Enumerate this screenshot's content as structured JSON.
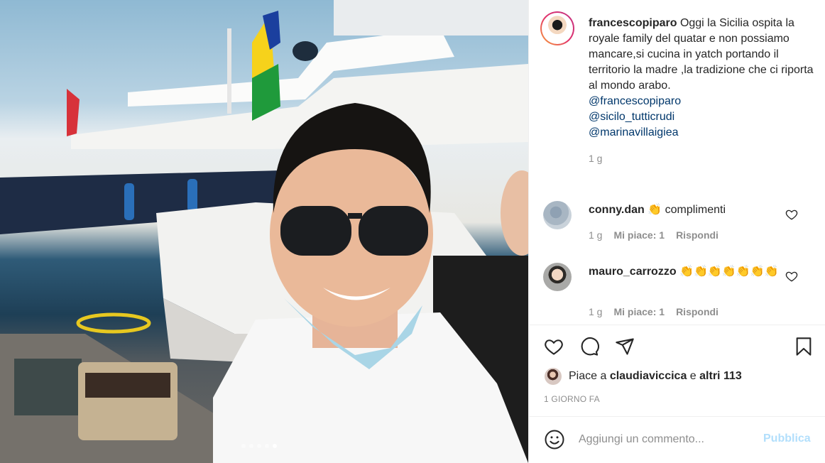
{
  "post": {
    "carousel": {
      "total": 5,
      "active_index": 5
    },
    "author": {
      "username": "francescopiparo",
      "caption": "Oggi la Sicilia ospita la royale family del quatar e non possiamo mancare,si cucina in yatch portando il territorio la madre ,la tradizione che ci riporta al mondo arabo.",
      "mentions": [
        "@francescopiparo",
        "@sicilo_tutticrudi",
        "@marinavillaigiea"
      ],
      "time": "1 g"
    },
    "comments": [
      {
        "username": "conny.dan",
        "text": "👏 complimenti",
        "time": "1 g",
        "likes": "Mi piace: 1",
        "reply": "Rispondi"
      },
      {
        "username": "mauro_carrozzo",
        "text": "👏👏👏👏👏👏👏",
        "time": "1 g",
        "likes": "Mi piace: 1",
        "reply": "Rispondi"
      }
    ],
    "likes": {
      "prefix": "Piace a",
      "user": "claudiaviccica",
      "and": "e",
      "others": "altri 113"
    },
    "date": "1 GIORNO FA",
    "composer": {
      "placeholder": "Aggiungi un commento...",
      "publish_label": "Pubblica"
    },
    "icons": {
      "like": "heart-icon",
      "comment": "comment-bubble-icon",
      "share": "paper-plane-icon",
      "save": "bookmark-icon",
      "emoji": "smiley-icon"
    },
    "colors": {
      "link": "#00376b",
      "muted": "#8e8e8e",
      "publish_disabled": "#b2dffc",
      "story_ring_start": "#f9a43a",
      "story_ring_end": "#c13584"
    }
  }
}
